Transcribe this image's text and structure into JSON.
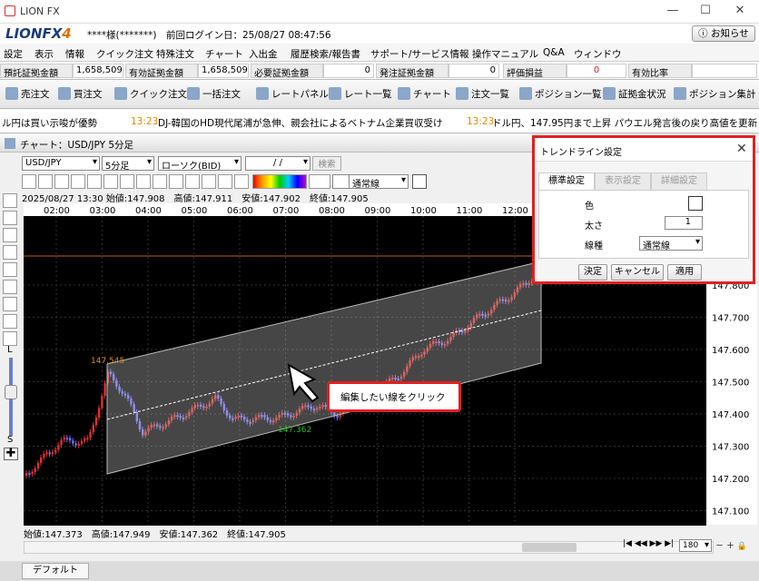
{
  "app": {
    "title": "LION FX",
    "logo_main": "LIONFX",
    "logo_num": "4"
  },
  "user": {
    "name": "****様(*******)",
    "last_login": "前回ログイン日：25/08/27 08:47:56"
  },
  "notice_label": "お知らせ",
  "menu": [
    "設定",
    "表示",
    "情報",
    "クイック注文",
    "特殊注文",
    "チャート",
    "入出金",
    "履歴検索/報告書",
    "サポート/サービス情報",
    "操作マニュアル",
    "Q&A",
    "ウィンドウ"
  ],
  "stats": [
    {
      "label": "預託証拠金額",
      "value": "1,658,509"
    },
    {
      "label": "有効証拠金額",
      "value": "1,658,509"
    },
    {
      "label": "必要証拠金額",
      "value": "0"
    },
    {
      "label": "発注証拠金額",
      "value": "0"
    },
    {
      "label": "評価損益",
      "value": "0"
    },
    {
      "label": "有効比率",
      "value": ""
    }
  ],
  "toolbar": [
    "売注文",
    "買注文",
    "クイック注文",
    "一括注文",
    "レートパネル",
    "レート一覧",
    "チャート",
    "注文一覧",
    "ポジション一覧",
    "証拠金状況",
    "ポジション集計"
  ],
  "ticker": [
    {
      "text": "ル円は買い示唆が優勢"
    },
    {
      "time": "13:23",
      "text": "DJ-韓国のHD現代尾浦が急伸、親会社によるベトナム企業買収受け"
    },
    {
      "time": "13:23",
      "text": "ドル円、147.95円まで上昇 パウエル発言後の戻り高値を更新"
    }
  ],
  "chart_window": {
    "title": "チャート：USD/JPY 5分足",
    "pair": "USD/JPY",
    "timeframe": "5分足",
    "chart_type": "ローソク(BID)",
    "date_placeholder": "/ /",
    "search_label": "検索",
    "line_width": "1",
    "line_style": "通常線",
    "info_top": "2025/08/27 13:30 始値:147.908　高値:147.911　安値:147.902　終値:147.905",
    "info_bottom": "始値:147.373　高値:147.949　安値:147.362　終値:147.905",
    "time_labels": [
      "02:00",
      "03:00",
      "04:00",
      "05:00",
      "06:00",
      "07:00",
      "08:00",
      "09:00",
      "10:00",
      "11:00",
      "12:00"
    ],
    "price_labels": [
      "147.800",
      "147.700",
      "147.600",
      "147.500",
      "147.400",
      "147.300",
      "147.200",
      "147.100"
    ],
    "annotation_high": "147.545",
    "annotation_low": "147.362",
    "bars_count": "180",
    "tab_default": "デフォルト"
  },
  "dialog": {
    "title": "トレンドライン設定",
    "tabs": [
      "標準設定",
      "表示設定",
      "詳細設定"
    ],
    "color_label": "色",
    "width_label": "太さ",
    "width_value": "1",
    "style_label": "線種",
    "style_value": "通常線",
    "ok": "決定",
    "cancel": "キャンセル",
    "apply": "適用"
  },
  "callout_text": "編集したい線をクリック",
  "colors": {
    "accent_red": "#e02020",
    "bg_chart": "#000000",
    "up": "#e03030",
    "down": "#6a6aff",
    "channel": "#808080"
  }
}
